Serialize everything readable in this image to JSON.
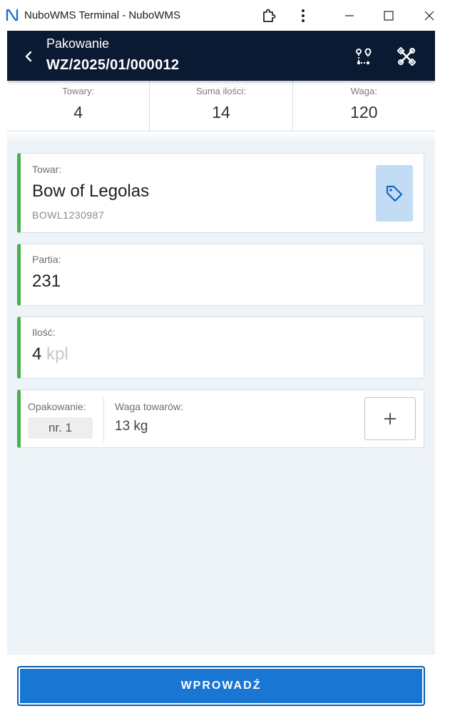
{
  "window": {
    "title": "NuboWMS Terminal - NuboWMS"
  },
  "header": {
    "title": "Pakowanie",
    "document_number": "WZ/2025/01/000012"
  },
  "stats": [
    {
      "label": "Towary:",
      "value": "4"
    },
    {
      "label": "Suma ilości:",
      "value": "14"
    },
    {
      "label": "Waga:",
      "value": "120"
    }
  ],
  "product": {
    "label": "Towar:",
    "name": "Bow of Legolas",
    "code": "BOWL1230987"
  },
  "batch": {
    "label": "Partia:",
    "value": "231"
  },
  "quantity": {
    "label": "Ilość:",
    "value": "4",
    "unit": "kpl"
  },
  "packaging": {
    "label": "Opakowanie:",
    "value": "nr. 1",
    "weight_label": "Waga towarów:",
    "weight_value": "13 kg"
  },
  "footer": {
    "submit_label": "WPROWADŹ"
  },
  "colors": {
    "header_bg": "#0a1a33",
    "accent_green": "#4caf50",
    "primary_blue": "#1976d2",
    "tag_bg": "#c2dcf5"
  }
}
